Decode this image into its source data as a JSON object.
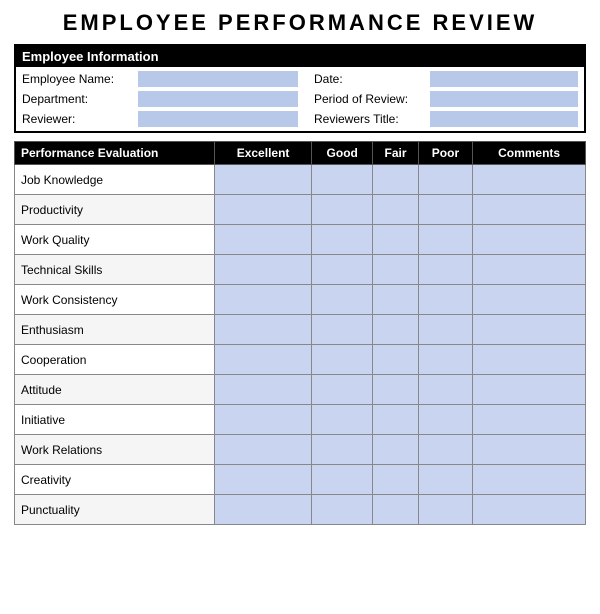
{
  "title": "EMPLOYEE  PERFORMANCE  REVIEW",
  "info": {
    "header": "Employee Information",
    "fields": [
      {
        "label": "Employee Name:",
        "label2": "Date:"
      },
      {
        "label": "Department:",
        "label2": "Period of Review:"
      },
      {
        "label": "Reviewer:",
        "label2": "Reviewers Title:"
      }
    ]
  },
  "table": {
    "headers": [
      "Performance Evaluation",
      "Excellent",
      "Good",
      "Fair",
      "Poor",
      "Comments"
    ],
    "rows": [
      "Job Knowledge",
      "Productivity",
      "Work Quality",
      "Technical Skills",
      "Work Consistency",
      "Enthusiasm",
      "Cooperation",
      "Attitude",
      "Initiative",
      "Work Relations",
      "Creativity",
      "Punctuality"
    ]
  }
}
